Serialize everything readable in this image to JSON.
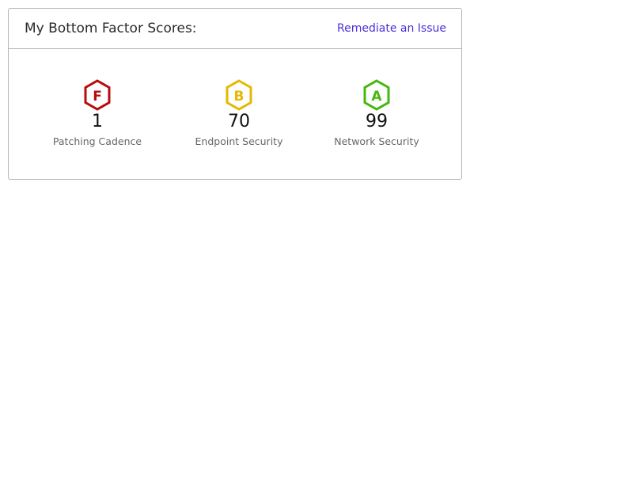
{
  "card": {
    "title": "My Bottom Factor Scores:",
    "action_link": "Remediate an Issue",
    "link_color": "#4f2ed8"
  },
  "scores": [
    {
      "grade": "F",
      "value": "1",
      "label": "Patching Cadence",
      "color": "#b80c0c"
    },
    {
      "grade": "B",
      "value": "70",
      "label": "Endpoint Security",
      "color": "#e6b800"
    },
    {
      "grade": "A",
      "value": "99",
      "label": "Network Security",
      "color": "#46b80a"
    }
  ]
}
